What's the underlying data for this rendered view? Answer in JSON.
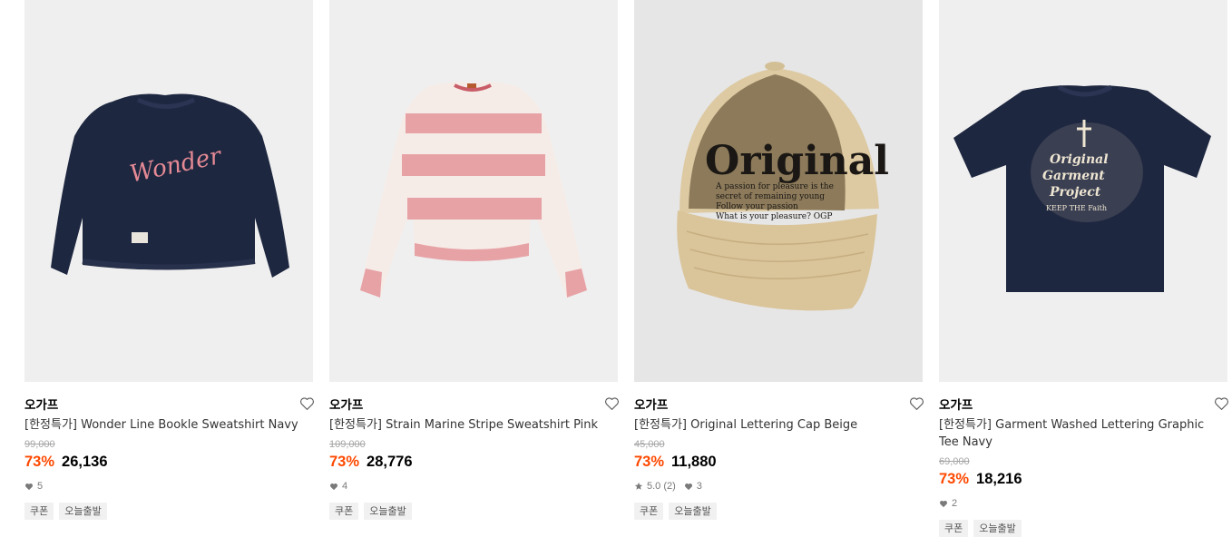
{
  "products": [
    {
      "brand": "오가프",
      "name": "[한정특가] Wonder Line Bookle Sweatshirt Navy",
      "original_price": "99,000",
      "discount": "73%",
      "price": "26,136",
      "likes": "5",
      "rating": null,
      "tags": [
        "쿠폰",
        "오늘출발"
      ],
      "image_icon": "navy-sweatshirt-image",
      "graphic_text": "Wonder"
    },
    {
      "brand": "오가프",
      "name": "[한정특가] Strain Marine Stripe Sweatshirt Pink",
      "original_price": "109,000",
      "discount": "73%",
      "price": "28,776",
      "likes": "4",
      "rating": null,
      "tags": [
        "쿠폰",
        "오늘출발"
      ],
      "image_icon": "pink-stripe-sweatshirt-image"
    },
    {
      "brand": "오가프",
      "name": "[한정특가] Original Lettering Cap Beige",
      "original_price": "45,000",
      "discount": "73%",
      "price": "11,880",
      "likes": "3",
      "rating": "5.0 (2)",
      "tags": [
        "쿠폰",
        "오늘출발"
      ],
      "image_icon": "beige-cap-image",
      "graphic_text": "Original",
      "graphic_lines": [
        "A passion for pleasure is the",
        "secret of remaining young",
        "Follow your passion",
        "What is your pleasure? OGP"
      ]
    },
    {
      "brand": "오가프",
      "name": "[한정특가] Garment Washed Lettering Graphic Tee Navy",
      "original_price": "69,000",
      "discount": "73%",
      "price": "18,216",
      "likes": "2",
      "rating": null,
      "tags": [
        "쿠폰",
        "오늘출발"
      ],
      "image_icon": "navy-graphic-tee-image",
      "graphic_lines": [
        "Original",
        "Garment",
        "Project",
        "KEEP THE Faith"
      ]
    }
  ],
  "colors": {
    "discount": "#ff4800",
    "image_bg": "#efefef",
    "tag_bg": "#f1f1f1",
    "navy": "#1e2740",
    "pink": "#e7a2a6",
    "beige": "#dcc9a0"
  }
}
